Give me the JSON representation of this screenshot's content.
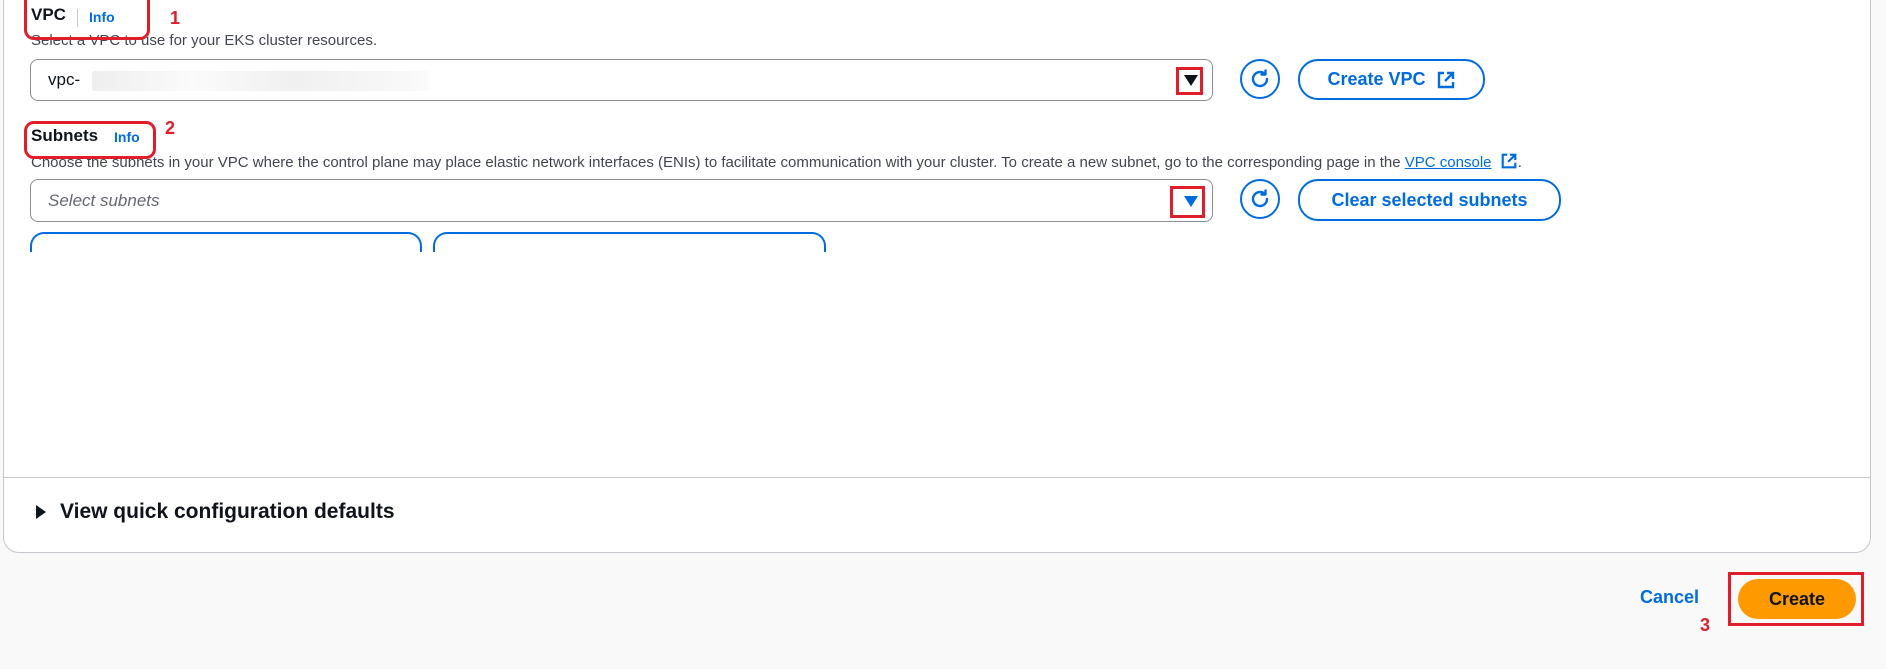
{
  "vpc": {
    "label": "VPC",
    "info": "Info",
    "description": "Select a VPC to use for your EKS cluster resources.",
    "selected_value": "vpc-",
    "create_button": "Create VPC"
  },
  "subnets": {
    "label": "Subnets",
    "info": "Info",
    "description_prefix": "Choose the subnets in your VPC where the control plane may place elastic network interfaces (ENIs) to facilitate communication with your cluster. To create a new subnet, go to the corresponding page in the ",
    "description_link": "VPC console",
    "description_suffix": ".",
    "placeholder": "Select subnets",
    "clear_button": "Clear selected subnets"
  },
  "expander": {
    "label": "View quick configuration defaults"
  },
  "footer": {
    "cancel": "Cancel",
    "create": "Create"
  },
  "annotations": {
    "one": "1",
    "two": "2",
    "three": "3"
  },
  "icons": {
    "caret": "caret-down-icon",
    "refresh": "refresh-icon",
    "external": "external-link-icon",
    "expand": "triangle-right-icon"
  },
  "colors": {
    "link": "#006ce0",
    "primary": "#ff9900",
    "annotation": "#e01e2b"
  }
}
